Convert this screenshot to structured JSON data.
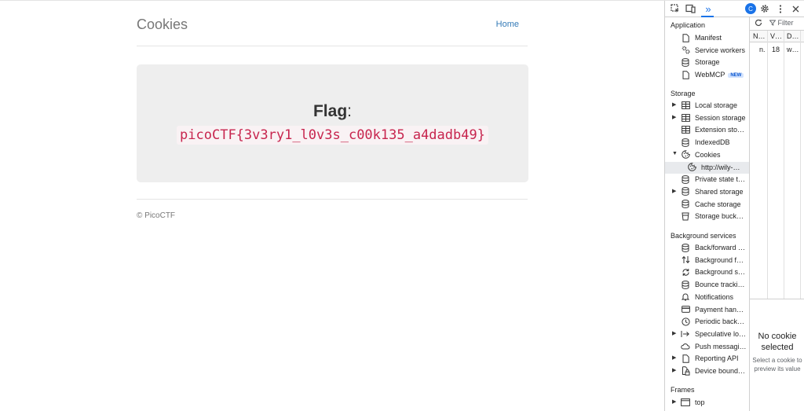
{
  "page": {
    "brand": "Cookies",
    "nav_home": "Home",
    "flag_label": "Flag",
    "flag_colon": ":",
    "flag_value": "picoCTF{3v3ry1_l0v3s_c00k135_a4dadb49}",
    "footer": "© PicoCTF"
  },
  "devtools": {
    "toolbar": {
      "more_tabs": "»",
      "ai_badge": "C"
    },
    "sections": {
      "application": "Application",
      "storage": "Storage",
      "background": "Background services",
      "frames": "Frames"
    },
    "application_items": [
      {
        "label": "Manifest",
        "icon": "file-icon"
      },
      {
        "label": "Service workers",
        "icon": "gears-icon"
      },
      {
        "label": "Storage",
        "icon": "database-icon"
      },
      {
        "label": "WebMCP",
        "icon": "file-icon",
        "badge": "NEW"
      }
    ],
    "storage_items": [
      {
        "label": "Local storage",
        "icon": "table-icon"
      },
      {
        "label": "Session storage",
        "icon": "table-icon"
      },
      {
        "label": "Extension stor…",
        "icon": "table-icon"
      },
      {
        "label": "IndexedDB",
        "icon": "database-icon"
      },
      {
        "label": "Cookies",
        "icon": "cookie-icon"
      },
      {
        "label": "http://wily-…",
        "icon": "cookie-icon"
      },
      {
        "label": "Private state t…",
        "icon": "database-icon"
      },
      {
        "label": "Shared storage",
        "icon": "database-icon"
      },
      {
        "label": "Cache storage",
        "icon": "database-icon"
      },
      {
        "label": "Storage buck…",
        "icon": "bucket-icon"
      }
    ],
    "background_items": [
      {
        "label": "Back/forward …",
        "icon": "database-icon"
      },
      {
        "label": "Background f…",
        "icon": "fetch-icon"
      },
      {
        "label": "Background s…",
        "icon": "sync-icon"
      },
      {
        "label": "Bounce tracki…",
        "icon": "database-icon"
      },
      {
        "label": "Notifications",
        "icon": "bell-icon"
      },
      {
        "label": "Payment han…",
        "icon": "card-icon"
      },
      {
        "label": "Periodic back…",
        "icon": "clock-icon"
      },
      {
        "label": "Speculative lo…",
        "icon": "arrow-icon"
      },
      {
        "label": "Push messagi…",
        "icon": "cloud-icon"
      },
      {
        "label": "Reporting API",
        "icon": "file-icon"
      },
      {
        "label": "Device bound…",
        "icon": "lock-icon"
      }
    ],
    "frames_items": [
      {
        "label": "top",
        "icon": "frame-icon"
      }
    ],
    "cookies_table": {
      "filter_placeholder": "Filter",
      "columns": [
        "N…",
        "V…",
        "D…"
      ],
      "row": [
        "n.",
        "18",
        "w…"
      ]
    },
    "preview": {
      "title": "No cookie selected",
      "subtitle": "Select a cookie to preview its value"
    }
  }
}
